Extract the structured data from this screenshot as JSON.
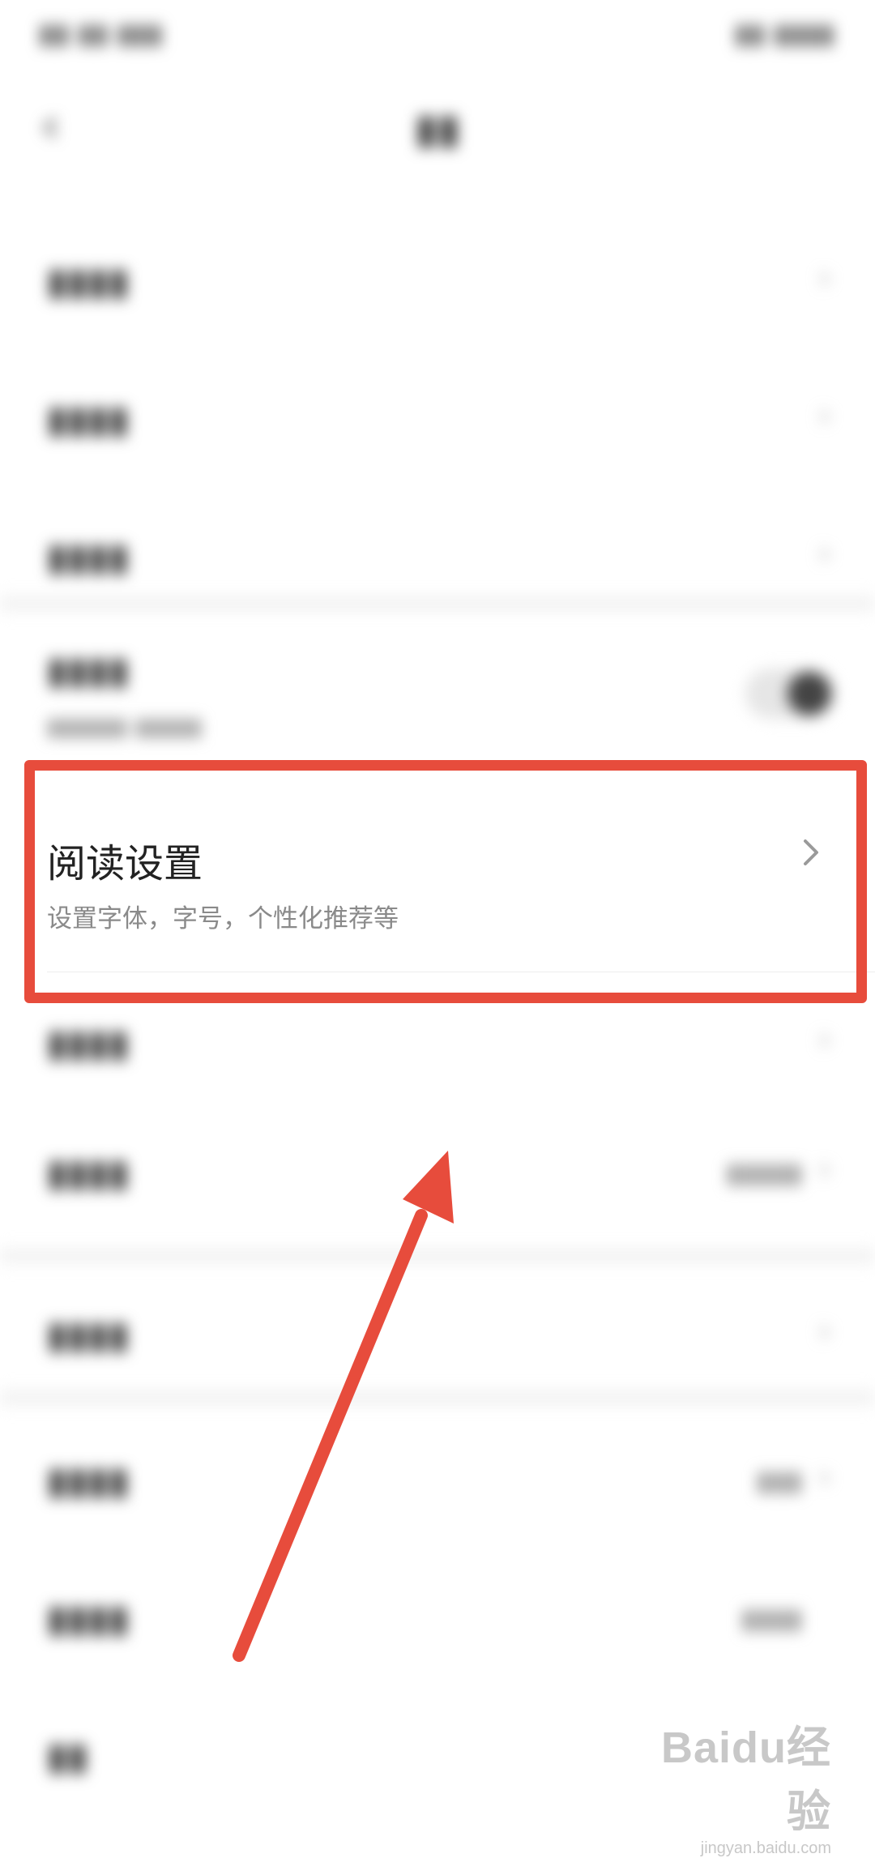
{
  "settings": {
    "reading": {
      "label": "阅读设置",
      "subtitle": "设置字体，字号，个性化推荐等"
    }
  },
  "watermark": {
    "main": "Baidu经验",
    "sub": "jingyan.baidu.com"
  },
  "colors": {
    "highlight": "#e74c3c",
    "arrow": "#e74c3c"
  },
  "icons": {
    "reading_chevron": "chevron-right-icon",
    "back": "back-icon"
  }
}
